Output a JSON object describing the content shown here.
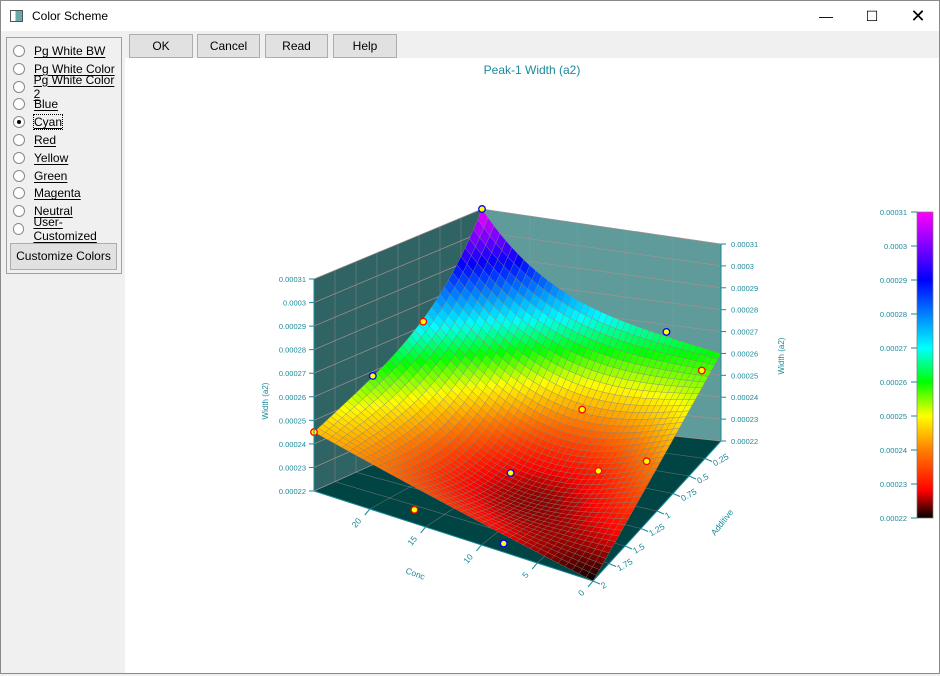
{
  "window": {
    "title": "Color Scheme",
    "minimize_icon": "minimize-icon",
    "maximize_icon": "maximize-icon",
    "close_icon": "close-icon"
  },
  "schemes": [
    {
      "label": "Pg White BW",
      "selected": false
    },
    {
      "label": "Pg White Color",
      "selected": false
    },
    {
      "label": "Pg White Color 2",
      "selected": false
    },
    {
      "label": "Blue",
      "selected": false
    },
    {
      "label": "Cyan",
      "selected": true
    },
    {
      "label": "Red",
      "selected": false
    },
    {
      "label": "Yellow",
      "selected": false
    },
    {
      "label": "Green",
      "selected": false
    },
    {
      "label": "Magenta",
      "selected": false
    },
    {
      "label": "Neutral",
      "selected": false
    },
    {
      "label": "User-Customized",
      "selected": false
    }
  ],
  "customize_label": "Customize Colors",
  "toolbar": {
    "ok": "OK",
    "cancel": "Cancel",
    "read": "Read",
    "help": "Help"
  },
  "colors": {
    "axis_text": "#1a8a9a",
    "left_wall": "#306464",
    "right_wall": "#5f9b9b",
    "floor": "#004444",
    "grid": "#a89090"
  },
  "chart_data": {
    "type": "surface3d",
    "title": "Peak-1 Width (a2)",
    "xlabel": "Conc",
    "ylabel": "Additive",
    "zlabel": "Width (a2)",
    "x_ticks": [
      "0",
      "5",
      "10",
      "15",
      "20"
    ],
    "x_tick_values": [
      0,
      5,
      10,
      15,
      20
    ],
    "xlim": [
      0,
      25
    ],
    "y_ticks": [
      "0.25",
      "0.5",
      "0.75",
      "1",
      "1.25",
      "1.5",
      "1.75",
      "2"
    ],
    "y_tick_values": [
      0.25,
      0.5,
      0.75,
      1,
      1.25,
      1.5,
      1.75,
      2
    ],
    "ylim": [
      0,
      2
    ],
    "z_ticks": [
      "0.00022",
      "0.00023",
      "0.00024",
      "0.00025",
      "0.00026",
      "0.00027",
      "0.00028",
      "0.00029",
      "0.0003",
      "0.00031"
    ],
    "zlim": [
      0.00022,
      0.00031
    ],
    "surface_corners": {
      "conc25_add0": 0.00031,
      "conc25_add2": 0.000245,
      "conc0_add0": 0.00026,
      "conc0_add2": 0.00022
    },
    "points": [
      {
        "conc": 25,
        "additive": 0,
        "width": 0.00031,
        "ring": "blue"
      },
      {
        "conc": 25,
        "additive": 0.7,
        "width": 0.000272,
        "ring": "red"
      },
      {
        "conc": 25,
        "additive": 1.3,
        "width": 0.000258,
        "ring": "blue"
      },
      {
        "conc": 25,
        "additive": 2,
        "width": 0.000245,
        "ring": "red"
      },
      {
        "conc": 5,
        "additive": 0.1,
        "width": 0.00027,
        "ring": "blue"
      },
      {
        "conc": 0,
        "additive": 0.3,
        "width": 0.000262,
        "ring": "red"
      },
      {
        "conc": 1,
        "additive": 1,
        "width": 0.000242,
        "ring": "red"
      },
      {
        "conc": 10,
        "additive": 0.6,
        "width": 0.000245,
        "ring": "red"
      },
      {
        "conc": 12,
        "additive": 1.3,
        "width": 0.000232,
        "ring": "blue"
      },
      {
        "conc": 5,
        "additive": 1.1,
        "width": 0.000236,
        "ring": "red"
      },
      {
        "conc": 16,
        "additive": 2,
        "width": 0.000226,
        "ring": "red"
      },
      {
        "conc": 8,
        "additive": 2,
        "width": 0.000224,
        "ring": "blue"
      }
    ],
    "colorbar": {
      "ticks": [
        "0.00031",
        "0.0003",
        "0.00029",
        "0.00028",
        "0.00027",
        "0.00026",
        "0.00025",
        "0.00024",
        "0.00023",
        "0.00022"
      ],
      "stops": [
        [
          "0.00022",
          "#000000"
        ],
        [
          "0.000228",
          "#ff0000"
        ],
        [
          "0.00024",
          "#ff7f00"
        ],
        [
          "0.00025",
          "#ffff00"
        ],
        [
          "0.00026",
          "#00ff00"
        ],
        [
          "0.00027",
          "#00ffff"
        ],
        [
          "0.00029",
          "#0000ff"
        ],
        [
          "0.00031",
          "#ff00ff"
        ]
      ]
    }
  }
}
